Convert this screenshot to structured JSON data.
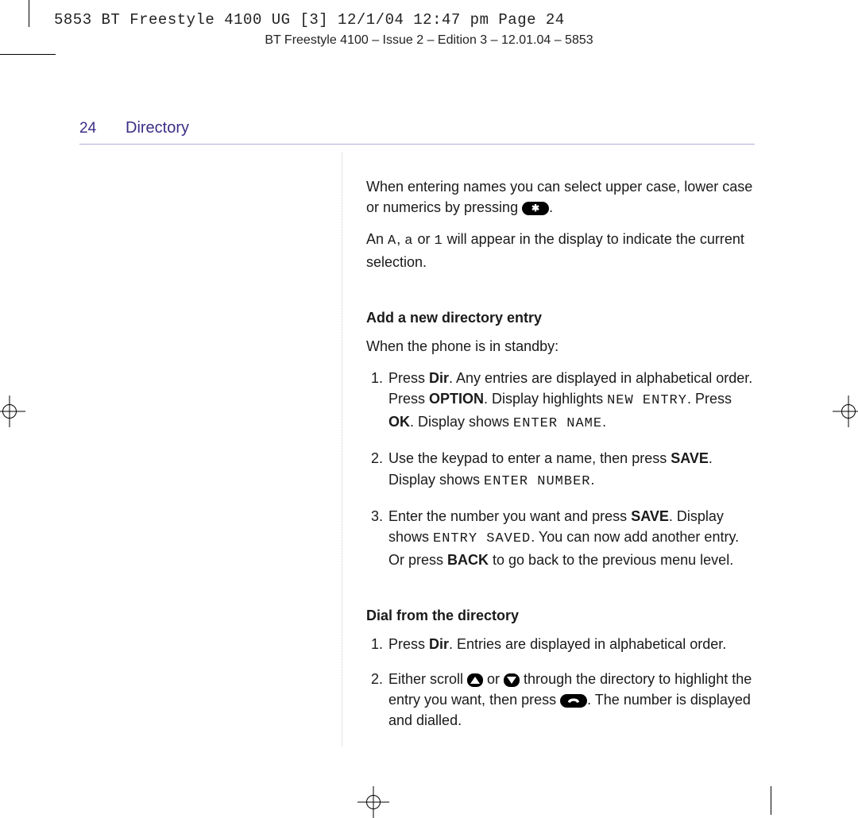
{
  "slug_line": "5853 BT Freestyle 4100 UG [3]  12/1/04  12:47 pm  Page 24",
  "running_head": "BT Freestyle 4100 – Issue 2 – Edition 3 – 12.01.04 – 5853",
  "page_number": "24",
  "section_title": "Directory",
  "intro": {
    "p1_a": "When entering names you can select upper case, lower case or numerics by pressing ",
    "p1_b": ".",
    "p2_a": "An ",
    "p2_A": "A",
    "p2_mid1": ", ",
    "p2_a_lc": "a",
    "p2_mid2": " or ",
    "p2_1": "1",
    "p2_b": " will appear in the display to indicate the current selection."
  },
  "add_entry": {
    "heading": "Add a new directory entry",
    "lead": "When the phone is in standby:",
    "step1": {
      "a": "Press ",
      "dir": "Dir",
      "b": ". Any entries are displayed in alphabetical order. Press ",
      "option": "OPTION",
      "c": ". Display highlights ",
      "lcd1": "NEW ENTRY",
      "d": ". Press ",
      "ok": "OK",
      "e": ". Display shows ",
      "lcd2": "ENTER NAME",
      "f": "."
    },
    "step2": {
      "a": "Use the keypad to enter a name, then press ",
      "save": "SAVE",
      "b": ". Display shows ",
      "lcd": "ENTER NUMBER",
      "c": "."
    },
    "step3": {
      "a": "Enter the number you want and press ",
      "save": "SAVE",
      "b": ". Display shows ",
      "lcd": "ENTRY SAVED",
      "c": ". You can now add another entry. Or press ",
      "back": "BACK",
      "d": " to go back to the previous menu level."
    }
  },
  "dial": {
    "heading": "Dial from the directory",
    "step1": {
      "a": "Press ",
      "dir": "Dir",
      "b": ". Entries are displayed in alphabetical order."
    },
    "step2": {
      "a": "Either scroll ",
      "mid": " or ",
      "b": " through the directory to highlight the entry you want, then press ",
      "c": ". The number is displayed and dialled."
    }
  },
  "icons": {
    "star_label": "✱",
    "up_label": "▲",
    "down_label": "▼",
    "talk_label": "☎"
  }
}
